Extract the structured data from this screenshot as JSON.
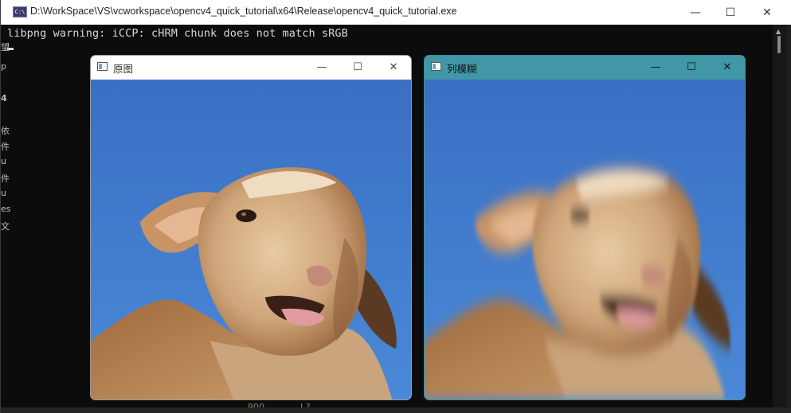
{
  "console": {
    "title": "D:\\WorkSpace\\VS\\vcworkspace\\opencv4_quick_tutorial\\x64\\Release\\opencv4_quick_tutorial.exe",
    "icon": "console-app-icon",
    "icon_text": "C:\\",
    "output_line": "libpng warning: iCCP: cHRM chunk does not match sRGB",
    "minimize_glyph": "—",
    "maximize_glyph": "☐",
    "close_glyph": "✕"
  },
  "background_fragments": [
    "望",
    "p",
    "4",
    "依",
    "件",
    "u",
    "件",
    "u",
    "es",
    "文",
    "900",
    "I ?"
  ],
  "windows": {
    "original": {
      "title": "原图",
      "icon": "image-window-icon",
      "minimize_glyph": "—",
      "maximize_glyph": "☐",
      "close_glyph": "✕"
    },
    "blurred": {
      "title": "列模糊",
      "icon": "image-window-icon",
      "minimize_glyph": "—",
      "maximize_glyph": "☐",
      "close_glyph": "✕"
    }
  },
  "colors": {
    "console_bg": "#0c0c0c",
    "sky": "#3a78c8",
    "blur_titlebar": "#4297a7"
  }
}
